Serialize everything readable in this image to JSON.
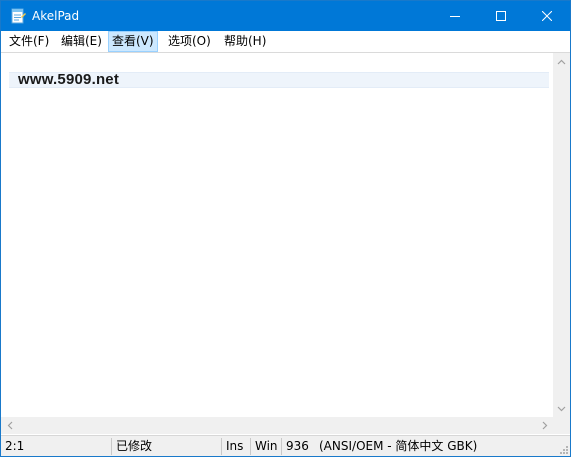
{
  "window": {
    "title": "AkelPad",
    "app_icon": "notepad-icon"
  },
  "controls": {
    "minimize_icon": "minimize-icon",
    "maximize_icon": "maximize-icon",
    "close_icon": "close-icon"
  },
  "menu": {
    "items": [
      {
        "label": "文件(F)"
      },
      {
        "label": "编辑(E)"
      },
      {
        "label": "查看(V)",
        "active": true
      },
      {
        "label": "选项(O)"
      },
      {
        "label": "帮助(H)"
      }
    ]
  },
  "editor": {
    "lines": [
      "www.5909.net"
    ]
  },
  "statusbar": {
    "position": "2:1",
    "modified": "已修改",
    "insert_mode": "Ins",
    "newline": "Win",
    "codepage": "936",
    "encoding": "(ANSI/OEM - 简体中文 GBK)"
  },
  "colors": {
    "titlebar": "#0078d7",
    "menu_highlight": "#cce8ff",
    "current_line": "#eef4fb"
  }
}
